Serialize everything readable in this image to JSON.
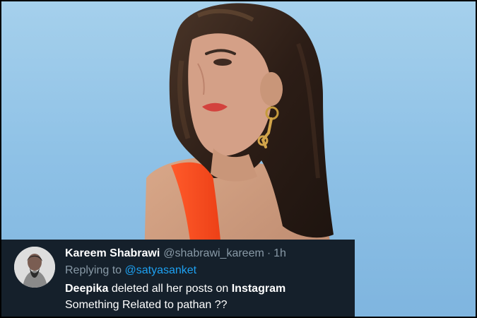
{
  "tweet": {
    "author_name": "Kareem Shabrawi",
    "author_handle": "@shabrawi_kareem",
    "separator": "·",
    "time": "1h",
    "replying_prefix": "Replying to",
    "replying_to": "@satyasanket",
    "text": {
      "line1_name": "Deepika",
      "line1_mid": " deleted all her posts on ",
      "line1_platform": "Instagram",
      "line2": "Something Related to pathan ??"
    }
  },
  "colors": {
    "card_background": "#15202b",
    "primary_text": "#ffffff",
    "secondary_text": "#8899a6",
    "link": "#1da1f2",
    "photo_background": "#8fc2e6",
    "dress": "#ff4a1c"
  },
  "icons": {
    "avatar": "user-avatar",
    "photo": "woman-portrait-photo"
  }
}
